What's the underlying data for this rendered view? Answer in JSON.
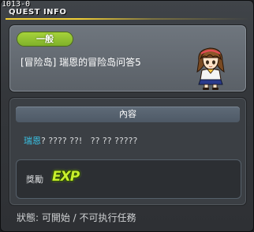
{
  "window": {
    "quest_id": "1013-0",
    "title": "QUEST INFO"
  },
  "quest": {
    "category": "一般",
    "name": "[冒险岛] 瑞恩的冒险岛问答5"
  },
  "content": {
    "header": "內容",
    "npc_name": "瑞恩",
    "text": "? ???? ??!   ?? ?? ?????"
  },
  "reward": {
    "label": "獎勵",
    "icon": "exp-icon",
    "exp_text": "EXP"
  },
  "status": {
    "text": "狀態:  可開始 / 不可执行任務"
  }
}
